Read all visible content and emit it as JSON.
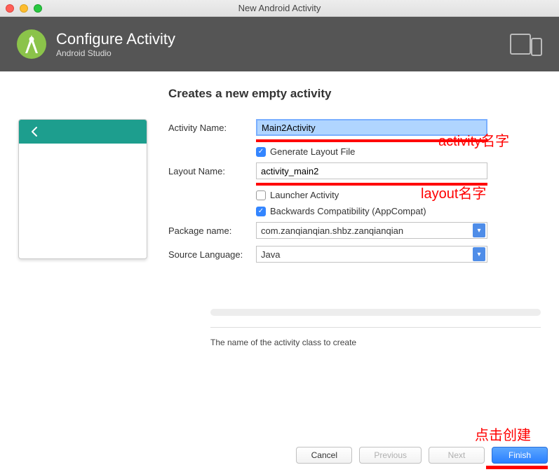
{
  "window": {
    "title": "New Android Activity"
  },
  "header": {
    "title": "Configure Activity",
    "subtitle": "Android Studio"
  },
  "form": {
    "title": "Creates a new empty activity",
    "activity_label": "Activity Name:",
    "activity_value": "Main2Activity",
    "generate_layout_label": "Generate Layout File",
    "generate_layout_checked": true,
    "layout_label": "Layout Name:",
    "layout_value": "activity_main2",
    "launcher_label": "Launcher Activity",
    "launcher_checked": false,
    "compat_label": "Backwards Compatibility (AppCompat)",
    "compat_checked": true,
    "package_label": "Package name:",
    "package_value": "com.zanqianqian.shbz.zanqianqian",
    "language_label": "Source Language:",
    "language_value": "Java"
  },
  "help_text": "The name of the activity class to create",
  "buttons": {
    "cancel": "Cancel",
    "previous": "Previous",
    "next": "Next",
    "finish": "Finish"
  },
  "annotations": {
    "activity": "activity名字",
    "layout": "layout名字",
    "finish": "点击创建"
  }
}
